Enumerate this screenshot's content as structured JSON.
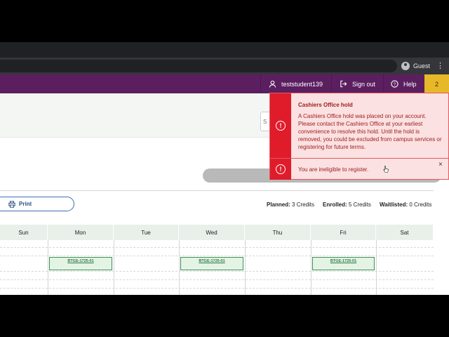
{
  "browser": {
    "profile_label": "Guest",
    "menu_icon": "kebab-icon"
  },
  "nav": {
    "username": "teststudent139",
    "sign_out": "Sign out",
    "help": "Help",
    "notification_count": "2"
  },
  "search": {
    "partial_text": "S"
  },
  "toolbar": {
    "print_label": "Print",
    "planned_label": "Planned:",
    "planned_value": "3 Credits",
    "enrolled_label": "Enrolled:",
    "enrolled_value": "5 Credits",
    "waitlisted_label": "Waitlisted:",
    "waitlisted_value": "0 Credits"
  },
  "calendar": {
    "days": [
      "Sun",
      "Mon",
      "Tue",
      "Wed",
      "Thu",
      "Fri",
      "Sat"
    ],
    "courses": [
      {
        "day": "Mon",
        "label": "BTGE-1725-01"
      },
      {
        "day": "Wed",
        "label": "BTGE-1725-01"
      },
      {
        "day": "Fri",
        "label": "BTGE-1725-01"
      }
    ]
  },
  "alerts": {
    "hold_title": "Cashiers Office hold",
    "hold_body": "A Cashiers Office hold was placed on your account. Please contact the Cashiers Office at your earliest convenience to resolve this hold. Until the hold is removed, you could be excluded from campus services or registering for future terms.",
    "ineligible_message": "You are ineligible to register.",
    "close_symbol": "×"
  },
  "colors": {
    "nav_bg": "#5b1f60",
    "badge_bg": "#e7b828",
    "alert_red": "#e01c2b",
    "alert_bg": "#fbe1e1",
    "course_green": "#3f8f55"
  }
}
